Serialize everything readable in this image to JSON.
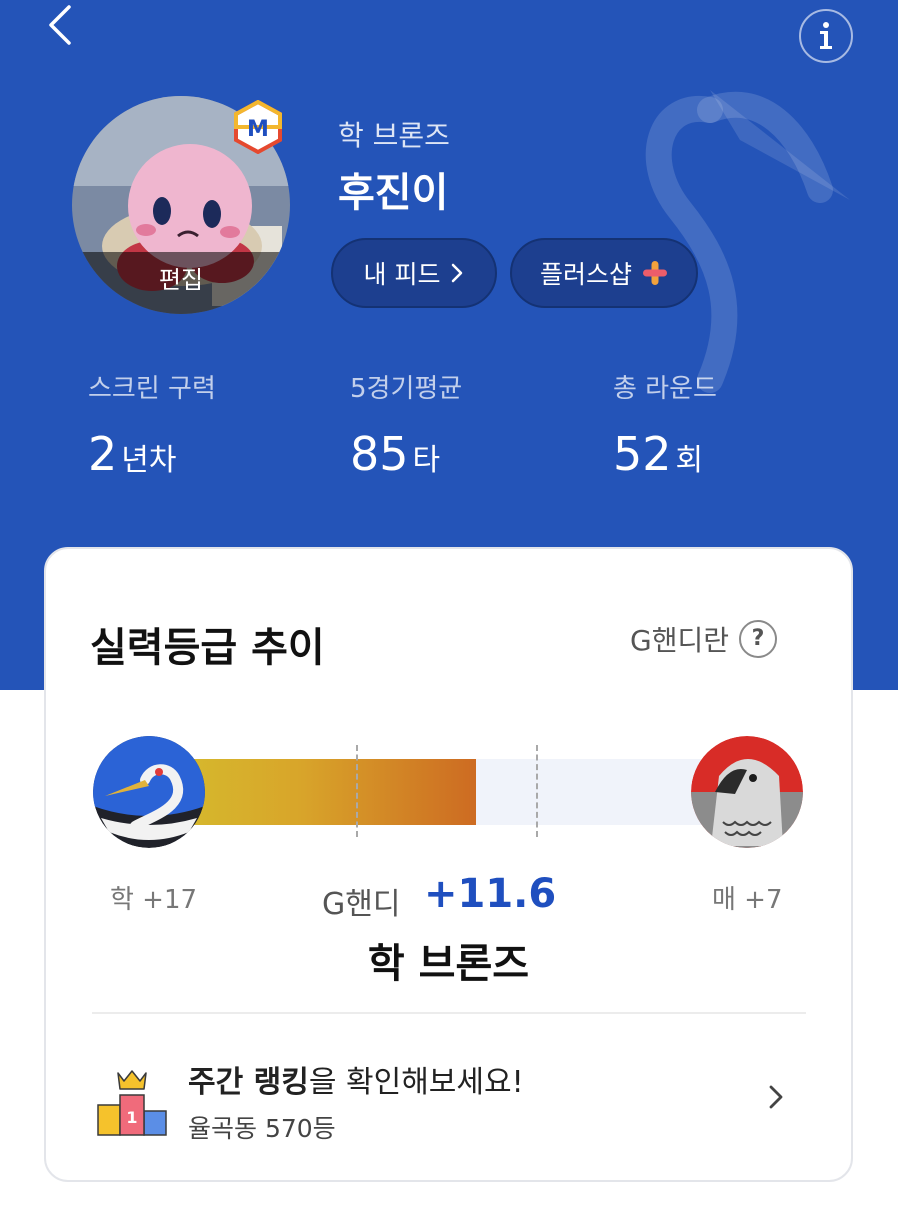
{
  "header": {
    "grade_name": "학 브론즈",
    "user_name": "후진이",
    "avatar_edit_label": "편집",
    "badge_letter": "M"
  },
  "actions": {
    "feed_label": "내 피드",
    "shop_label": "플러스샵"
  },
  "stats": [
    {
      "label": "스크린 구력",
      "value": "2",
      "unit": "년차"
    },
    {
      "label": "5경기평균",
      "value": "85",
      "unit": "타"
    },
    {
      "label": "총 라운드",
      "value": "52",
      "unit": "회"
    }
  ],
  "card": {
    "title": "실력등급 추이",
    "help_label": "G핸디란",
    "help_symbol": "?",
    "left_tier": "학 +17",
    "right_tier": "매 +7",
    "ghandi_label": "G핸디",
    "ghandi_value": "+11.6",
    "progress": 0.54,
    "current_grade": "학 브론즈"
  },
  "ranking": {
    "bold_text": "주간 랭킹",
    "rest_text": "을 확인해보세요!",
    "detail": "율곡동 570등",
    "podium_number": "1"
  },
  "colors": {
    "hero_bg": "#2454b8",
    "accent_blue": "#1f4fbf",
    "bar_start": "#d5bd2e",
    "bar_end": "#cd6b22"
  },
  "icons": [
    "back-icon",
    "info-icon",
    "chevron-right-icon",
    "plus-icon",
    "crane-icon",
    "hawk-icon",
    "podium-icon",
    "crown-icon"
  ]
}
